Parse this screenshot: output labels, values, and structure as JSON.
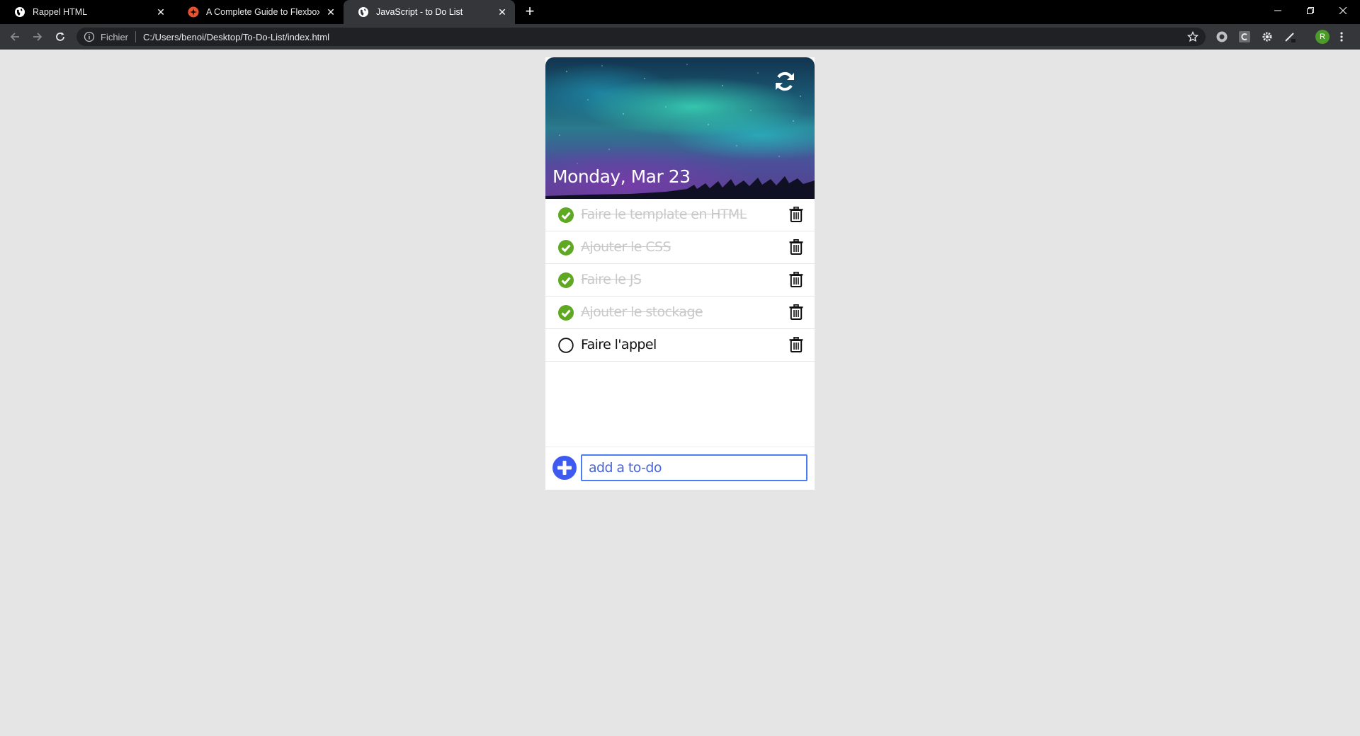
{
  "browser": {
    "tabs": [
      {
        "title": "Rappel HTML",
        "favicon": "globe-icon",
        "active": false
      },
      {
        "title": "A Complete Guide to Flexbox | C",
        "favicon": "css-tricks-icon",
        "active": false
      },
      {
        "title": "JavaScript - to Do List",
        "favicon": "globe-icon",
        "active": true
      }
    ],
    "address": {
      "scheme_label": "Fichier",
      "url": "C:/Users/benoi/Desktop/To-Do-List/index.html"
    },
    "profile_initial": "R"
  },
  "app": {
    "date": "Monday, Mar 23",
    "todos": [
      {
        "text": "Faire le template en HTML",
        "done": true
      },
      {
        "text": "Ajouter le CSS",
        "done": true
      },
      {
        "text": "Faire le JS",
        "done": true
      },
      {
        "text": "Ajouter le stockage",
        "done": true
      },
      {
        "text": "Faire l'appel",
        "done": false
      }
    ],
    "input": {
      "placeholder": "add a to-do",
      "value": ""
    }
  },
  "colors": {
    "check_done": "#5fa821",
    "add_button": "#3d5af1",
    "input_border": "#4b7ef2",
    "page_bg": "#e5e5e5"
  }
}
